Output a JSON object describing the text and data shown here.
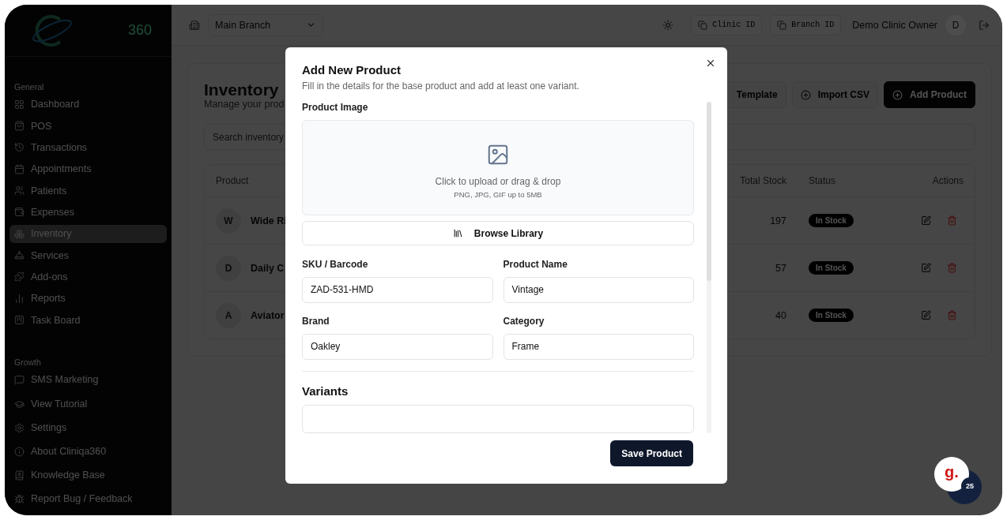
{
  "sidebar": {
    "logo_text": "360",
    "sections": [
      {
        "title": "General",
        "items": [
          {
            "label": "Dashboard",
            "selected": false
          },
          {
            "label": "POS",
            "selected": false
          },
          {
            "label": "Transactions",
            "selected": false
          },
          {
            "label": "Appointments",
            "selected": false
          },
          {
            "label": "Patients",
            "selected": false
          },
          {
            "label": "Expenses",
            "selected": false
          },
          {
            "label": "Inventory",
            "selected": true
          },
          {
            "label": "Services",
            "selected": false
          },
          {
            "label": "Add-ons",
            "selected": false
          },
          {
            "label": "Reports",
            "selected": false
          },
          {
            "label": "Task Board",
            "selected": false
          }
        ]
      },
      {
        "title": "Growth",
        "items": [
          {
            "label": "SMS Marketing",
            "selected": false
          }
        ]
      }
    ],
    "footer_items": [
      "View Tutorial",
      "Settings",
      "About Cliniqa360",
      "Knowledge Base",
      "Report Bug / Feedback"
    ]
  },
  "topbar": {
    "branch": "Main Branch",
    "clinic_id": "Clinic ID",
    "branch_id": "Branch ID",
    "user": "Demo Clinic Owner",
    "avatar": "D"
  },
  "page": {
    "title": "Inventory",
    "subtitle": "Manage your prod",
    "actions": [
      {
        "label": "Template",
        "kind": "outline"
      },
      {
        "label": "Import CSV",
        "kind": "outline"
      },
      {
        "label": "Add Product",
        "kind": "primary"
      }
    ],
    "search_placeholder": "Search inventory",
    "table": {
      "columns": [
        "Product",
        "Total Stock",
        "Status",
        "Actions"
      ],
      "rows": [
        {
          "avatar": "W",
          "name": "Wide Ri",
          "stock": "197",
          "status": "In Stock"
        },
        {
          "avatar": "D",
          "name": "Daily C",
          "stock": "57",
          "status": "In Stock"
        },
        {
          "avatar": "A",
          "name": "Aviator",
          "stock": "40",
          "status": "In Stock"
        }
      ]
    }
  },
  "modal": {
    "title": "Add New Product",
    "description": "Fill in the details for the base product and add at least one variant.",
    "image_label": "Product Image",
    "upload_text": "Click to upload or drag & drop",
    "upload_hint": "PNG, JPG, GIF up to 5MB",
    "browse_button": "Browse Library",
    "fields": [
      {
        "label": "SKU / Barcode",
        "value": "ZAD-531-HMD"
      },
      {
        "label": "Product Name",
        "value": "Vintage"
      },
      {
        "label": "Brand",
        "value": "Oakley"
      },
      {
        "label": "Category",
        "value": "Frame"
      }
    ],
    "variants_title": "Variants",
    "save_button": "Save Product"
  },
  "chat_widget": {
    "logo": "g.",
    "count": "25"
  }
}
